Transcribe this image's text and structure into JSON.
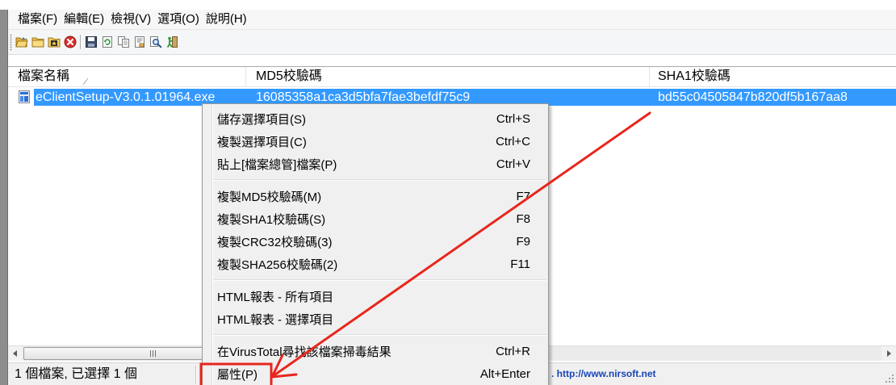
{
  "colors": {
    "selection": "#3399ff",
    "annotation": "#e8261d",
    "link": "#1a46b8"
  },
  "menubar": {
    "items": [
      "檔案(F)",
      "編輯(E)",
      "檢視(V)",
      "選項(O)",
      "說明(H)"
    ]
  },
  "toolbar": {
    "icons": [
      "open-files-icon",
      "open-folder-icon",
      "add-wildcard-icon",
      "delete-icon",
      "save-icon",
      "refresh-icon",
      "copy-icon",
      "properties-icon",
      "find-icon",
      "exit-icon"
    ]
  },
  "list": {
    "columns": [
      "檔案名稱",
      "MD5校驗碼",
      "SHA1校驗碼"
    ],
    "sort_icon": "sort-ascending-icon",
    "rows": [
      {
        "filename": "eClientSetup-V3.0.1.01964.exe",
        "md5": "16085358a1ca3d5bfa7fae3befdf75c9",
        "sha1": "bd55c04505847b820df5b167aa8",
        "selected": true
      }
    ]
  },
  "context_menu": {
    "groups": [
      [
        {
          "label": "儲存選擇項目(S)",
          "shortcut": "Ctrl+S"
        },
        {
          "label": "複製選擇項目(C)",
          "shortcut": "Ctrl+C"
        },
        {
          "label": "貼上[檔案總管]檔案(P)",
          "shortcut": "Ctrl+V"
        }
      ],
      [
        {
          "label": "複製MD5校驗碼(M)",
          "shortcut": "F7"
        },
        {
          "label": "複製SHA1校驗碼(S)",
          "shortcut": "F8"
        },
        {
          "label": "複製CRC32校驗碼(3)",
          "shortcut": "F9"
        },
        {
          "label": "複製SHA256校驗碼(2)",
          "shortcut": "F11"
        }
      ],
      [
        {
          "label": "HTML報表 - 所有項目"
        },
        {
          "label": "HTML報表 - 選擇項目"
        }
      ],
      [
        {
          "label": "在VirusTotal尋找該檔案掃毒結果",
          "shortcut": "Ctrl+R"
        },
        {
          "label": "屬性(P)",
          "shortcut": "Alt+Enter"
        }
      ]
    ]
  },
  "status": {
    "summary": "1 個檔案, 已選擇 1 個",
    "link": ". http://www.nirsoft.net"
  }
}
